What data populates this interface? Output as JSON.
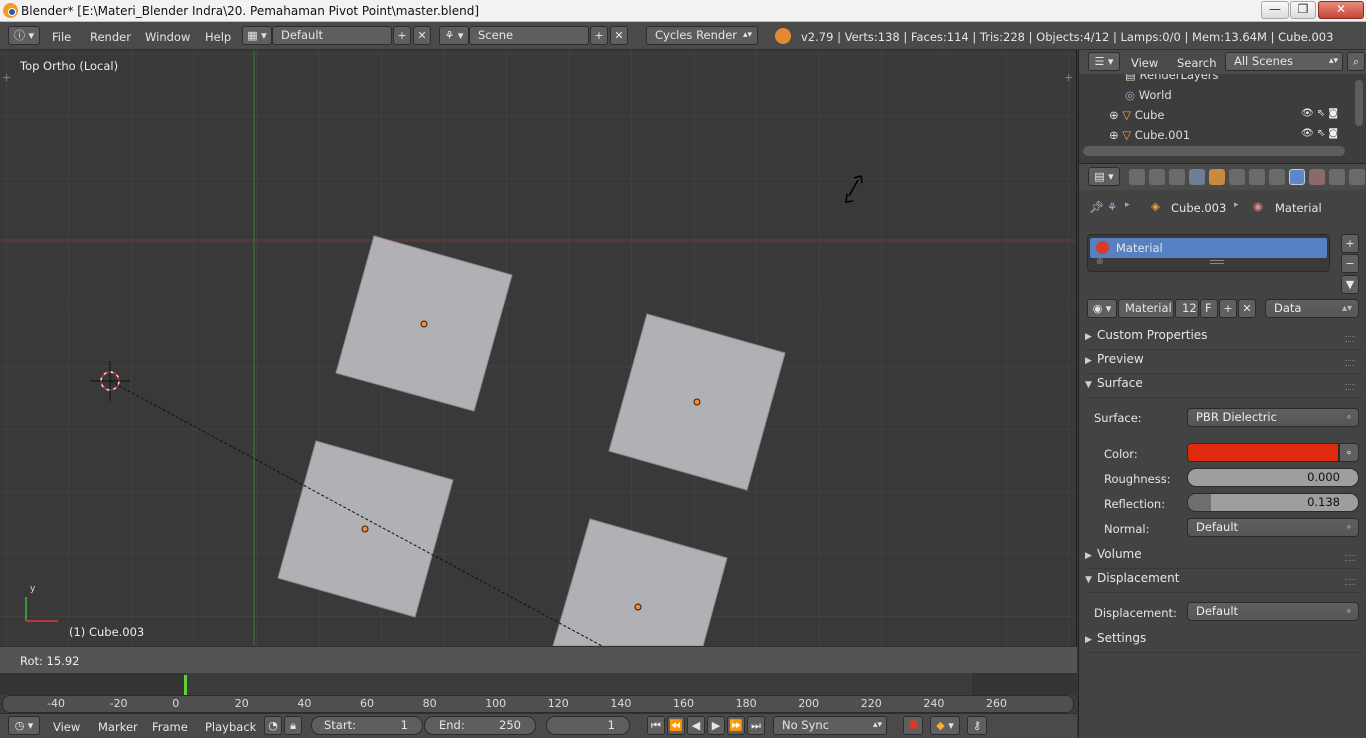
{
  "window": {
    "title": "Blender* [E:\\Materi_Blender Indra\\20. Pemahaman Pivot Point\\master.blend]",
    "controls": [
      "—",
      "❐",
      "✕"
    ]
  },
  "info_header": {
    "menus": [
      "File",
      "Render",
      "Window",
      "Help"
    ],
    "layout": "Default",
    "scene": "Scene",
    "engine": "Cycles Render",
    "stats": "v2.79 | Verts:138 | Faces:114 | Tris:228 | Objects:4/12 | Lamps:0/0 | Mem:13.64M | Cube.003"
  },
  "viewport": {
    "view_name": "Top Ortho (Local)",
    "object_label": "(1) Cube.003",
    "axis_y": "y",
    "operator_status": "Rot: 15.92",
    "colors": {
      "bg": "#393939",
      "grid": "#424242",
      "x_axis": "#8a3a3a",
      "y_axis": "#3f7a3f",
      "plane": "#b0b0b4",
      "origin": "#f0904a"
    }
  },
  "timeline": {
    "ticks": [
      "-40",
      "-20",
      "0",
      "20",
      "40",
      "60",
      "80",
      "100",
      "120",
      "140",
      "160",
      "180",
      "200",
      "220",
      "240",
      "260"
    ],
    "current_frame_marker": 1,
    "menus": [
      "View",
      "Marker",
      "Frame",
      "Playback"
    ],
    "start_label": "Start:",
    "start_value": "1",
    "end_label": "End:",
    "end_value": "250",
    "current_frame": "1",
    "sync": "No Sync"
  },
  "outliner": {
    "menus": [
      "View",
      "Search"
    ],
    "filter": "All Scenes",
    "items": [
      {
        "name": "RenderLayers",
        "icon": "render-layers-icon"
      },
      {
        "name": "World",
        "icon": "world-icon"
      },
      {
        "name": "Cube",
        "icon": "mesh-object-icon"
      },
      {
        "name": "Cube.001",
        "icon": "mesh-object-icon"
      }
    ]
  },
  "properties": {
    "breadcrumb": [
      "Cube.003",
      "Material"
    ],
    "material_slot": "Material",
    "datablock_name": "Material",
    "users": "12",
    "fake_user": "F",
    "link": "Data",
    "panels": {
      "custom_properties": "Custom Properties",
      "preview": "Preview",
      "surface": "Surface",
      "volume": "Volume",
      "displacement": "Displacement",
      "settings": "Settings"
    },
    "surface": {
      "surface_label": "Surface:",
      "surface_value": "PBR Dielectric",
      "color_label": "Color:",
      "color_value": "#e02a10",
      "roughness_label": "Roughness:",
      "roughness_value": "0.000",
      "roughness_fraction": 0.0,
      "reflection_label": "Reflection:",
      "reflection_value": "0.138",
      "reflection_fraction": 0.138,
      "normal_label": "Normal:",
      "normal_value": "Default"
    },
    "displacement": {
      "label": "Displacement:",
      "value": "Default"
    }
  }
}
